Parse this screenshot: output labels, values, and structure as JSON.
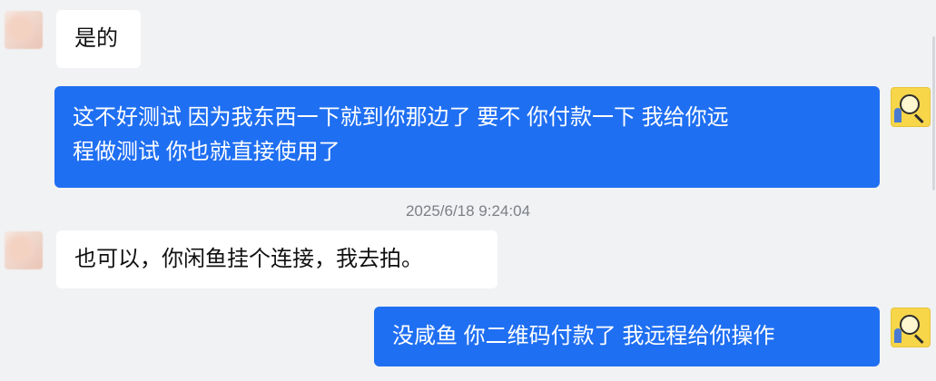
{
  "messages": [
    {
      "id": "m1",
      "direction": "incoming",
      "text": "是的"
    },
    {
      "id": "m2",
      "direction": "outgoing",
      "line1": "这不好测试 因为我东西一下就到你那边了  要不  你付款一下  我给你远",
      "line2": "程做测试  你也就直接使用了"
    },
    {
      "id": "m3",
      "direction": "incoming",
      "text": "也可以，你闲鱼挂个连接，我去拍。"
    },
    {
      "id": "m4",
      "direction": "outgoing",
      "text": "没咸鱼  你二维码付款了  我远程给你操作"
    }
  ],
  "timestamp": "2025/6/18 9:24:04",
  "colors": {
    "background": "#f1f2f4",
    "incoming_bubble": "#ffffff",
    "outgoing_bubble": "#1f6ff2",
    "timestamp_text": "#7c7f86"
  },
  "icons": {
    "incoming_avatar": "blurred-profile-avatar",
    "outgoing_avatar": "magnifier-cartoon-avatar"
  }
}
